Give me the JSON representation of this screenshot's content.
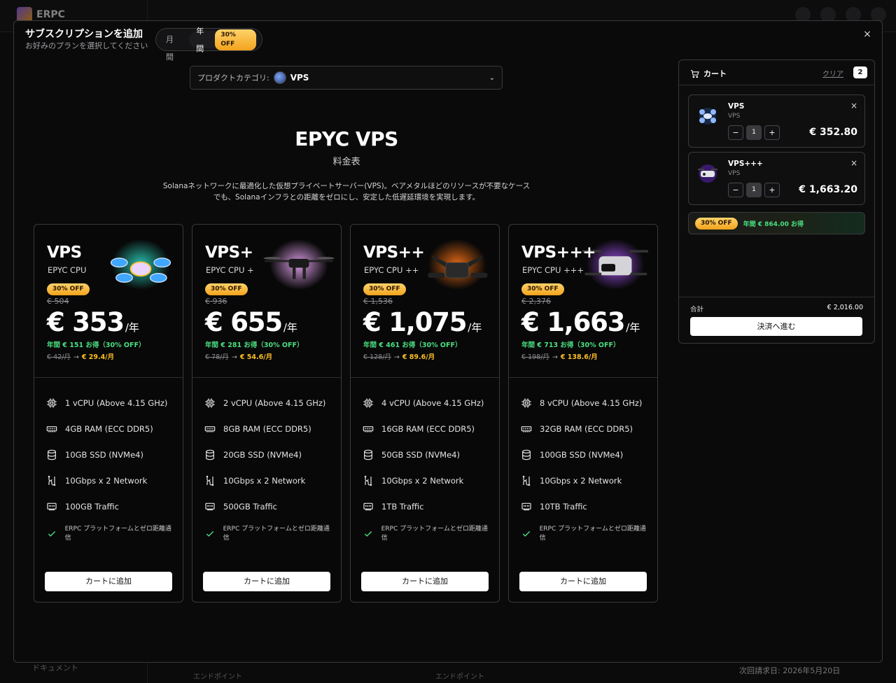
{
  "background": {
    "logo_text": "ERPC",
    "bottom_left": "ドキュメント",
    "bottom_mid1": "エンドポイント",
    "bottom_mid2": "エンドポイント",
    "bottom_right": "次回請求日: 2026年5月20日"
  },
  "modal": {
    "title": "サブスクリプションを追加",
    "subtitle": "お好みのプランを選択してください",
    "billing_toggle": {
      "monthly": "月間",
      "yearly": "年間",
      "yearly_badge": "30% OFF",
      "selected": "yearly"
    },
    "close_label": "×"
  },
  "category": {
    "label": "プロダクトカテゴリ:",
    "value": "VPS",
    "chevron": "⌄"
  },
  "hero": {
    "title": "EPYC VPS",
    "subtitle": "料金表",
    "description": "Solanaネットワークに最適化した仮想プライベートサーバー(VPS)。ベアメタルほどのリソースが不要なケースでも、Solanaインフラとの距離をゼロにし、安定した低遅延環境を実現します。"
  },
  "plans": [
    {
      "name": "VPS",
      "cpu": "EPYC CPU",
      "badge": "30% OFF",
      "orig_price": "€ 504",
      "price": "€ 353",
      "per": "/年",
      "save": "年間 € 151 お得（30% OFF）",
      "monthly_old": "€ 42/月",
      "arrow": "→",
      "monthly_new": "€ 29.4/月",
      "features": [
        "1 vCPU (Above 4.15 GHz)",
        "4GB RAM (ECC DDR5)",
        "10GB SSD (NVMe4)",
        "10Gbps x 2 Network",
        "100GB Traffic",
        "ERPC プラットフォームとゼロ距離通信"
      ],
      "button": "カートに追加",
      "art_color": "#3fa7ff",
      "art_glow": "#2dd4bf"
    },
    {
      "name": "VPS+",
      "cpu": "EPYC CPU +",
      "badge": "30% OFF",
      "orig_price": "€ 936",
      "price": "€ 655",
      "per": "/年",
      "save": "年間 € 281 お得（30% OFF）",
      "monthly_old": "€ 78/月",
      "arrow": "→",
      "monthly_new": "€ 54.6/月",
      "features": [
        "2 vCPU (Above 4.15 GHz)",
        "8GB RAM (ECC DDR5)",
        "20GB SSD (NVMe4)",
        "10Gbps x 2 Network",
        "500GB Traffic",
        "ERPC プラットフォームとゼロ距離通信"
      ],
      "button": "カートに追加",
      "art_color": "#1a1a1a",
      "art_glow": "#f0abfc"
    },
    {
      "name": "VPS++",
      "cpu": "EPYC CPU ++",
      "badge": "30% OFF",
      "orig_price": "€ 1,536",
      "price": "€ 1,075",
      "per": "/年",
      "save": "年間 € 461 お得（30% OFF）",
      "monthly_old": "€ 128/月",
      "arrow": "→",
      "monthly_new": "€ 89.6/月",
      "features": [
        "4 vCPU (Above 4.15 GHz)",
        "16GB RAM (ECC DDR5)",
        "50GB SSD (NVMe4)",
        "10Gbps x 2 Network",
        "1TB Traffic",
        "ERPC プラットフォームとゼロ距離通信"
      ],
      "button": "カートに追加",
      "art_color": "#222222",
      "art_glow": "#f97316"
    },
    {
      "name": "VPS+++",
      "cpu": "EPYC CPU +++",
      "badge": "30% OFF",
      "orig_price": "€ 2,376",
      "price": "€ 1,663",
      "per": "/年",
      "save": "年間 € 713 お得（30% OFF）",
      "monthly_old": "€ 198/月",
      "arrow": "→",
      "monthly_new": "€ 138.6/月",
      "features": [
        "8 vCPU (Above 4.15 GHz)",
        "32GB RAM (ECC DDR5)",
        "100GB SSD (NVMe4)",
        "10Gbps x 2 Network",
        "10TB Traffic",
        "ERPC プラットフォームとゼロ距離通信"
      ],
      "button": "カートに追加",
      "art_color": "#d4d4d8",
      "art_glow": "#a855f7"
    }
  ],
  "feature_icons": [
    "cpu-icon",
    "ram-icon",
    "database-icon",
    "network-icon",
    "ethernet-icon",
    "check-icon"
  ],
  "cart": {
    "title": "カート",
    "clear": "クリア",
    "count": "2",
    "items": [
      {
        "name": "VPS",
        "sub": "VPS",
        "qty": "1",
        "minus": "−",
        "plus": "+",
        "amount": "€ 352.80",
        "remove": "×"
      },
      {
        "name": "VPS+++",
        "sub": "VPS",
        "qty": "1",
        "minus": "−",
        "plus": "+",
        "amount": "€ 1,663.20",
        "remove": "×"
      }
    ],
    "promo_badge": "30% OFF",
    "promo_text": "年間 € 864.00 お得",
    "total_label": "合計",
    "total_value": "€ 2,016.00",
    "checkout": "決済へ進む"
  },
  "colors": {
    "accent_gold": "#f2a31c",
    "save_green": "#4ade80",
    "price_gold": "#fbbf24"
  }
}
